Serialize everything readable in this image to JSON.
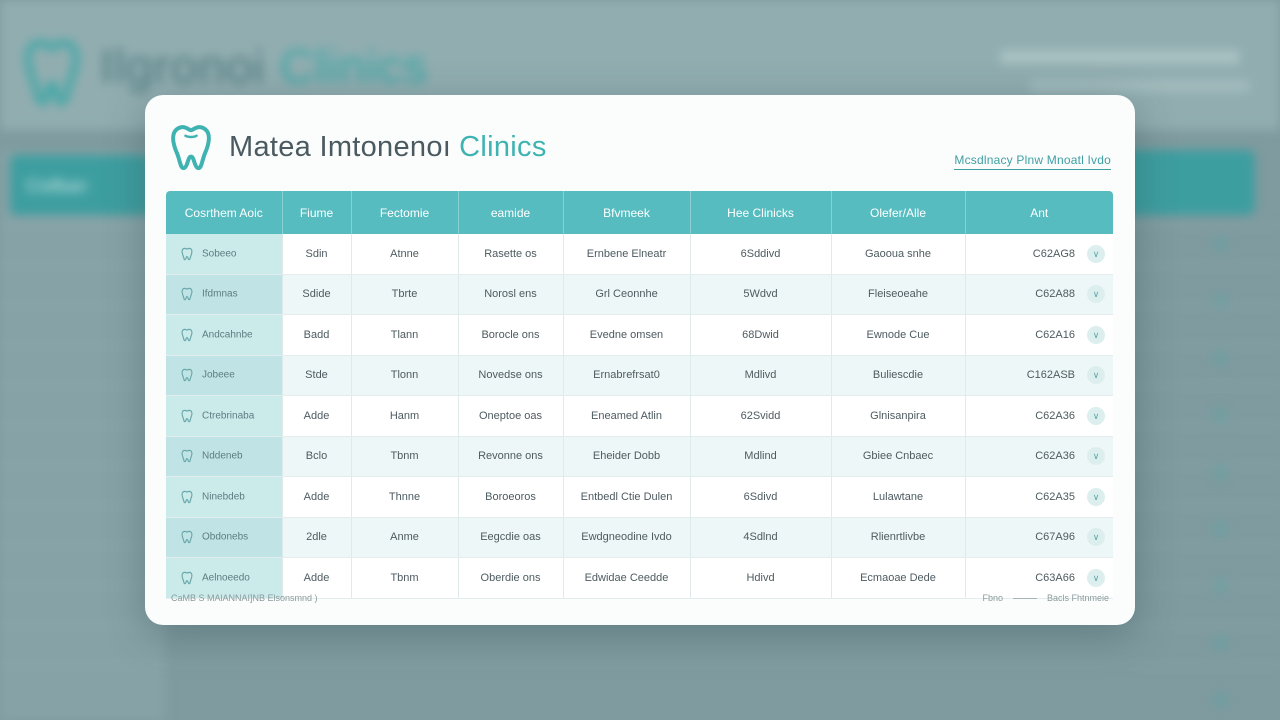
{
  "background": {
    "brand": "Ilgronoi",
    "brand_accent": "Clinics",
    "sidebar_header": "Cisfban",
    "row_count": 12
  },
  "card": {
    "brand_title": "Matea Imtonenoı",
    "brand_accent": "Clinics",
    "top_link": "Mcsdlnacy Plnw Mnoatl Ivdo",
    "columns": [
      "Cosrthem Aoic",
      "Fiume",
      "Fectomie",
      "eamide",
      "Bfvmeek",
      "Hee Clinicks",
      "Olefer/Alle",
      "Ant"
    ],
    "rows": [
      [
        "Sobeeo",
        "Sdin",
        "Atnne",
        "Rasette os",
        "Ernbene Elneatr",
        "6Sddivd",
        "Gaooua snhe",
        "C62AG8"
      ],
      [
        "Ifdmnas",
        "Sdide",
        "Tbrte",
        "Norosl ens",
        "Grl Ceonnhe",
        "5Wdvd",
        "Fleiseoeahe",
        "C62A88"
      ],
      [
        "Andcahnbe",
        "Badd",
        "Tlann",
        "Borocle ons",
        "Evedne omsen",
        "68Dwid",
        "Ewnode Cue",
        "C62A16"
      ],
      [
        "Jobeee",
        "Stde",
        "Tlonn",
        "Novedse ons",
        "Ernabrefrsat0",
        "Mdlivd",
        "Buliescdie",
        "C162ASB"
      ],
      [
        "Ctrebrinaba",
        "Adde",
        "Hanm",
        "Oneptoe oas",
        "Eneamed Atlin",
        "62Svidd",
        "Glnisanpira",
        "C62A36"
      ],
      [
        "Nddeneb",
        "Bclo",
        "Tbnm",
        "Revonne ons",
        "Eheider Dobb",
        "Mdlind",
        "Gbiee Cnbaec",
        "C62A36"
      ],
      [
        "Ninebdeb",
        "Adde",
        "Thnne",
        "Boroeoros",
        "Entbedl Ctie Dulen",
        "6Sdivd",
        "Lulawtane",
        "C62A35"
      ],
      [
        "Obdonebs",
        "2dle",
        "Anme",
        "Eegcdie oas",
        "Ewdgneodine Ivdo",
        "4Sdlnd",
        "Rlienrtlivbe",
        "C67A96"
      ],
      [
        "Aelnoeedo",
        "Adde",
        "Tbnm",
        "Oberdie ons",
        "Edwidae Ceedde",
        "Hdivd",
        "Ecmaoae Dede",
        "C63A66"
      ]
    ],
    "footer_left": "CaMB S  MAlANNAI]NB Elsonsmnd )",
    "footer_mid": "Fbno",
    "footer_right": "Bacls Fhtnmeie",
    "accent_color": "#56bcc0"
  }
}
